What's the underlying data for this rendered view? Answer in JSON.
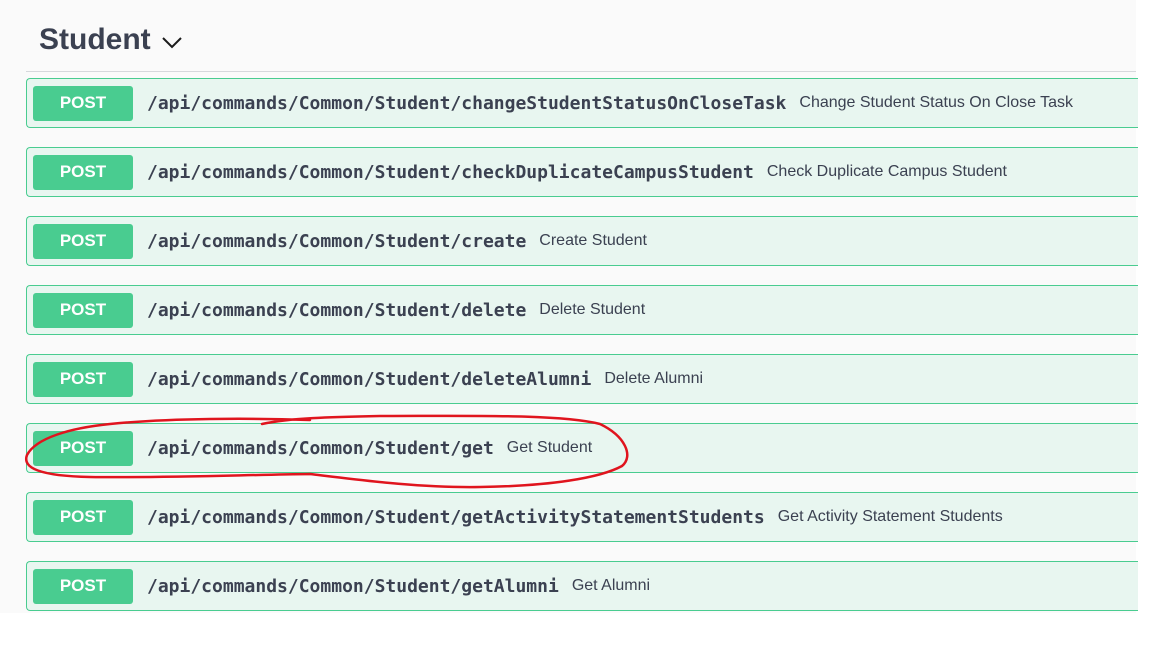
{
  "section": {
    "title": "Student",
    "toggle_icon": "chevron-down-icon"
  },
  "operations": [
    {
      "method": "POST",
      "path": "/api/commands/Common/Student/changeStudentStatusOnCloseTask",
      "summary": "Change Student Status On Close Task"
    },
    {
      "method": "POST",
      "path": "/api/commands/Common/Student/checkDuplicateCampusStudent",
      "summary": "Check Duplicate Campus Student"
    },
    {
      "method": "POST",
      "path": "/api/commands/Common/Student/create",
      "summary": "Create Student"
    },
    {
      "method": "POST",
      "path": "/api/commands/Common/Student/delete",
      "summary": "Delete Student"
    },
    {
      "method": "POST",
      "path": "/api/commands/Common/Student/deleteAlumni",
      "summary": "Delete Alumni"
    },
    {
      "method": "POST",
      "path": "/api/commands/Common/Student/get",
      "summary": "Get Student"
    },
    {
      "method": "POST",
      "path": "/api/commands/Common/Student/getActivityStatementStudents",
      "summary": "Get Activity Statement Students"
    },
    {
      "method": "POST",
      "path": "/api/commands/Common/Student/getAlumni",
      "summary": "Get Alumni"
    }
  ],
  "colors": {
    "post_method": "#49cc90",
    "post_background": "#e8f6f0",
    "text": "#3b4151",
    "annotation": "#e0141e"
  }
}
